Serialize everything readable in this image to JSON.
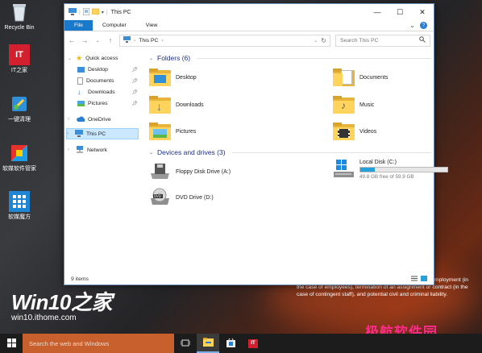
{
  "desktop": {
    "icons": [
      {
        "label": "Recycle Bin",
        "icon": "recycle-bin-icon"
      },
      {
        "label": "IT之家",
        "icon": "ithome-icon"
      },
      {
        "label": "一键清理",
        "icon": "cleaner-icon"
      },
      {
        "label": "软媒软件管家",
        "icon": "software-manager-icon"
      },
      {
        "label": "软媒魔方",
        "icon": "rubik-cube-icon"
      }
    ],
    "brand_title": "Win10之家",
    "brand_url": "win10.ithome.com",
    "background_text": "lt in disciplinary action up to and including termination of employment (in the case of employees), termination of an assignment or contract (in the case of contingent staff), and potential civil and criminal liability.",
    "watermark": "极航软件园"
  },
  "explorer": {
    "title": "This PC",
    "ribbon_tabs": [
      "File",
      "Computer",
      "View"
    ],
    "address_path": "This PC",
    "search_placeholder": "Search This PC",
    "nav_pane": {
      "quick_access": "Quick access",
      "quick_items": [
        "Desktop",
        "Documents",
        "Downloads",
        "Pictures"
      ],
      "onedrive": "OneDrive",
      "this_pc": "This PC",
      "network": "Network"
    },
    "folders_header": "Folders (6)",
    "folders": [
      "Desktop",
      "Documents",
      "Downloads",
      "Music",
      "Pictures",
      "Videos"
    ],
    "devices_header": "Devices and drives (3)",
    "drives": {
      "floppy": "Floppy Disk Drive (A:)",
      "local": "Local Disk (C:)",
      "local_free": "49.8 GB free of 59.9 GB",
      "local_used_fraction": 0.17,
      "dvd": "DVD Drive (D:)"
    },
    "status_items": "9 items"
  },
  "taskbar": {
    "search_placeholder": "Search the web and Windows"
  },
  "colors": {
    "accent": "#1979ca",
    "folder": "#ffd35c",
    "drive_bar": "#26a0da",
    "taskbar_search": "#c8602e"
  }
}
